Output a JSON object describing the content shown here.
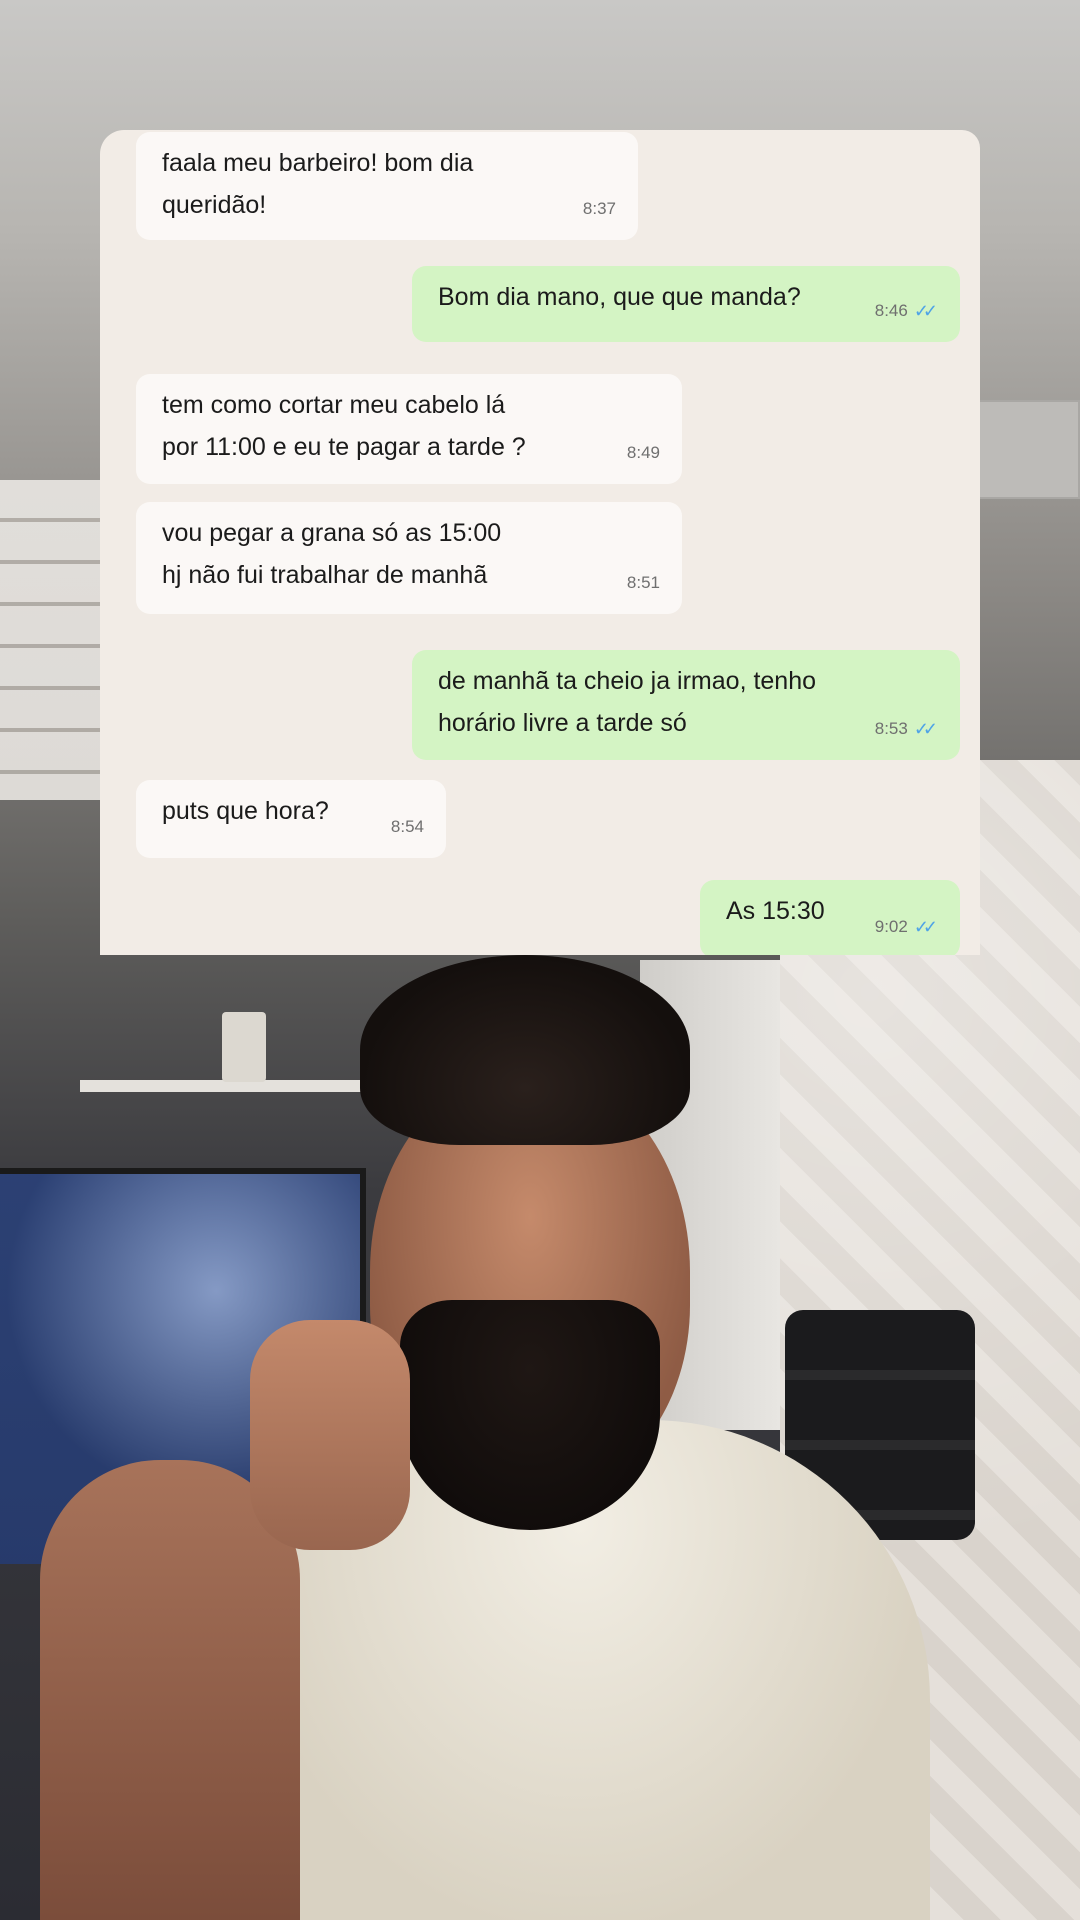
{
  "chat": {
    "messages": [
      {
        "direction": "incoming",
        "text": "faala meu barbeiro! bom dia\nqueridão!",
        "time": "8:37"
      },
      {
        "direction": "outgoing",
        "text": "Bom dia mano, que que manda?",
        "time": "8:46",
        "read": true
      },
      {
        "direction": "incoming",
        "text": "tem como cortar meu cabelo lá\npor 11:00 e eu te pagar a tarde ?",
        "time": "8:49"
      },
      {
        "direction": "incoming",
        "text": "vou pegar a grana só as 15:00\nhj não fui trabalhar de manhã",
        "time": "8:51"
      },
      {
        "direction": "outgoing",
        "text": "de manhã ta cheio ja irmao, tenho\nhorário livre a tarde só",
        "time": "8:53",
        "read": true
      },
      {
        "direction": "incoming",
        "text": "puts que hora?",
        "time": "8:54"
      },
      {
        "direction": "outgoing",
        "text": "As 15:30",
        "time": "9:02",
        "read": true
      }
    ],
    "read_tick_icon": "double-check-icon"
  },
  "colors": {
    "chat_background": "#f2ece6",
    "incoming_bubble": "#fbf8f6",
    "outgoing_bubble": "#d4f4c4",
    "read_ticks": "#4fa3e6"
  }
}
